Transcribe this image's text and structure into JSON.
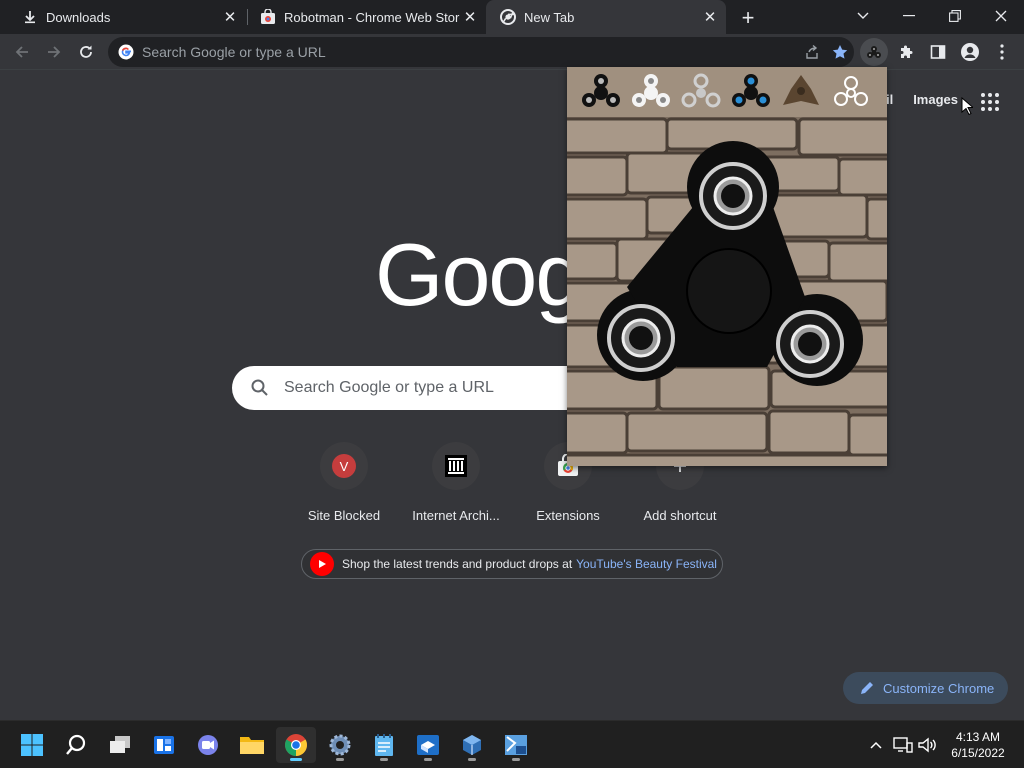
{
  "tabs": [
    {
      "title": "Downloads",
      "icon": "download-icon"
    },
    {
      "title": "Robotman - Chrome Web Store",
      "icon": "web-store-icon"
    },
    {
      "title": "New Tab",
      "icon": "chrome-icon",
      "active": true
    }
  ],
  "omnibox": {
    "placeholder": "Search Google or type a URL"
  },
  "ntp": {
    "links": {
      "gmail": "Gmail",
      "images": "Images"
    },
    "logo_text": "Google",
    "search_placeholder": "Search Google or type a URL",
    "shortcuts": [
      {
        "label": "Site Blocked",
        "letter": "V",
        "icon": "letter-v-icon"
      },
      {
        "label": "Internet Archi...",
        "icon": "archive-icon"
      },
      {
        "label": "Extensions",
        "icon": "web-store-icon"
      },
      {
        "label": "Add shortcut",
        "icon": "plus-icon"
      }
    ],
    "promo": {
      "text": "Shop the latest trends and product drops at",
      "link": "YouTube's Beauty Festival"
    },
    "customize": "Customize Chrome"
  },
  "popup": {
    "spinner_options": [
      "black-spinner",
      "white-spinner",
      "silver-spinner",
      "blue-spinner",
      "brown-spinner",
      "outline-spinner"
    ],
    "selected_spinner": "black-spinner"
  },
  "taskbar": {
    "apps": [
      "start",
      "search",
      "task-view",
      "widgets",
      "teams-chat",
      "file-explorer",
      "chrome",
      "settings",
      "notepad",
      "virtualbox-manager",
      "virtualbox",
      "xp-mode"
    ],
    "time": "4:13 AM",
    "date": "6/15/2022"
  },
  "colors": {
    "background": "#35363a",
    "tabstrip": "#202124",
    "accent": "#8ab4f8",
    "taskbar": "#202020"
  }
}
